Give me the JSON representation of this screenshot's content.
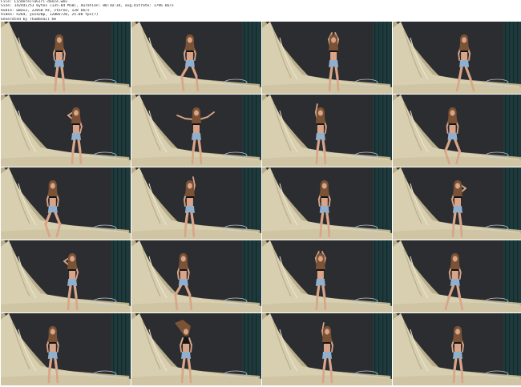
{
  "header": {
    "file": "File: CinderellaGirl-dance.wmv",
    "size": "Size: 142441753 bytes (135.84 MiB), duration: 00:10:34, avg.bitrate: 1796 kb/s",
    "audio": "Audio: wmav2, 22050 Hz, stereo, 128 kb/s",
    "video": "Video: h264, yuv420p, 1280x720, 25.00 fps(r)",
    "generator": "Generated by Thumbnail me"
  },
  "thumbnails": [
    {
      "pose": "stand",
      "figure_x": 0.45,
      "flip": false
    },
    {
      "pose": "sit",
      "figure_x": 0.45,
      "flip": false
    },
    {
      "pose": "arms-up",
      "figure_x": 0.55,
      "flip": false
    },
    {
      "pose": "lean",
      "figure_x": 0.55,
      "flip": true
    },
    {
      "pose": "hand-head",
      "figure_x": 0.58,
      "flip": false
    },
    {
      "pose": "arms-out",
      "figure_x": 0.5,
      "flip": false
    },
    {
      "pose": "arm-up",
      "figure_x": 0.45,
      "flip": false
    },
    {
      "pose": "crouch",
      "figure_x": 0.46,
      "flip": false
    },
    {
      "pose": "crouch",
      "figure_x": 0.4,
      "flip": false
    },
    {
      "pose": "arm-up",
      "figure_x": 0.45,
      "flip": true
    },
    {
      "pose": "stand",
      "figure_x": 0.48,
      "flip": false
    },
    {
      "pose": "hand-head",
      "figure_x": 0.5,
      "flip": true
    },
    {
      "pose": "hand-head",
      "figure_x": 0.55,
      "flip": false
    },
    {
      "pose": "sit",
      "figure_x": 0.4,
      "flip": false
    },
    {
      "pose": "arms-up",
      "figure_x": 0.45,
      "flip": false
    },
    {
      "pose": "lean",
      "figure_x": 0.48,
      "flip": false
    },
    {
      "pose": "stand",
      "figure_x": 0.4,
      "flip": false
    },
    {
      "pose": "hair-flip",
      "figure_x": 0.42,
      "flip": false
    },
    {
      "pose": "arm-up",
      "figure_x": 0.5,
      "flip": false
    },
    {
      "pose": "stand",
      "figure_x": 0.5,
      "flip": false
    }
  ],
  "colors": {
    "backdrop": "#2b2d30",
    "curtain": "#1f3a3c",
    "drape": "#d8cfb0",
    "drape_shadow": "#b9ae8c",
    "skin": "#d9a487",
    "hair": "#7a5235",
    "top": "#141414",
    "shorts": "#8fb0cf"
  }
}
